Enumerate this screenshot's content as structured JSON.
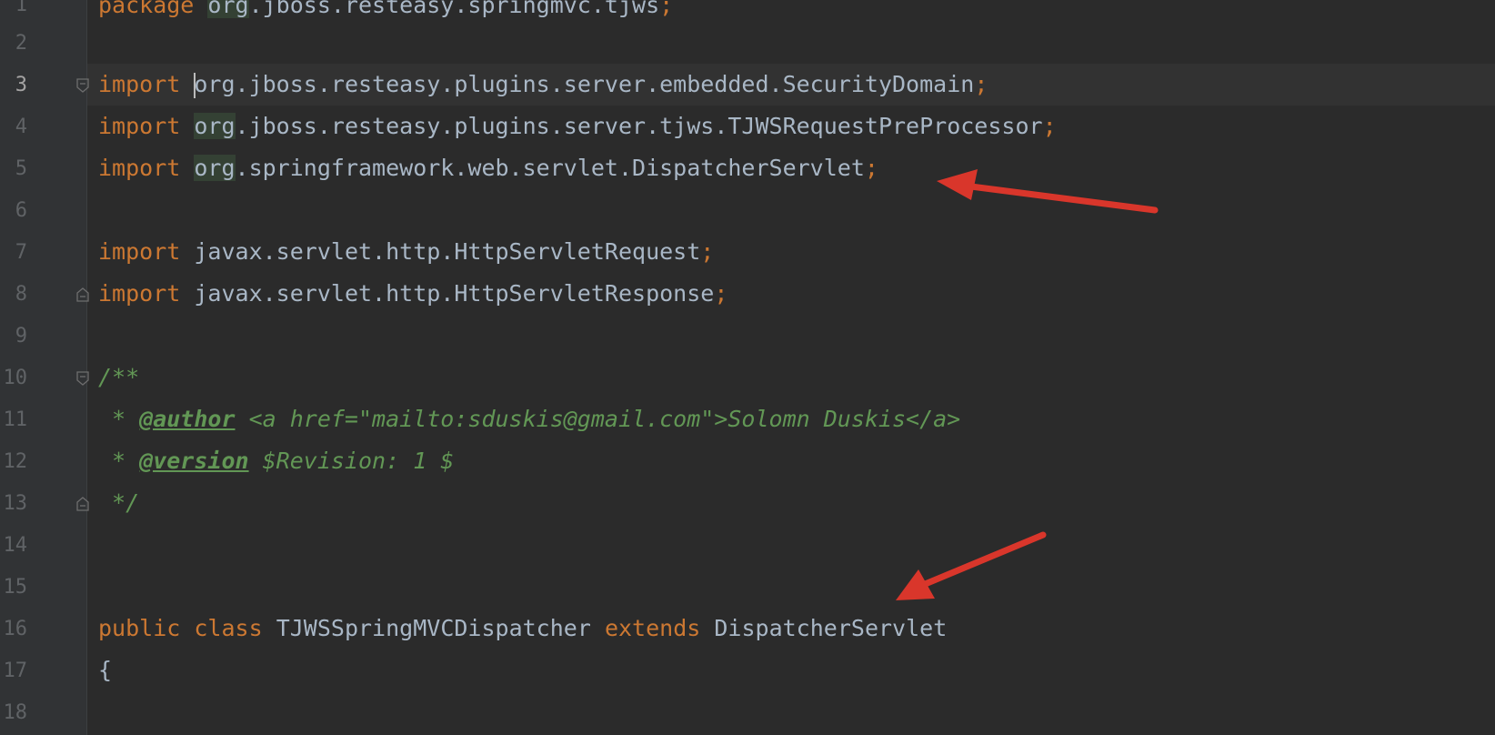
{
  "editor": {
    "current_line": 3,
    "colors": {
      "background": "#2b2b2b",
      "gutter": "#313335",
      "keyword": "#cc7832",
      "identifier": "#a9b7c6",
      "comment": "#629755",
      "annotation_arrow": "#d9362b"
    },
    "line_numbers": [
      "1",
      "2",
      "3",
      "4",
      "5",
      "6",
      "7",
      "8",
      "9",
      "10",
      "11",
      "12",
      "13",
      "14",
      "15",
      "16",
      "17",
      "18"
    ],
    "lines": {
      "l1": {
        "keyword": "package",
        "pkg_hl": "org",
        "rest": ".jboss.resteasy.springmvc.tjws",
        "semi": ";"
      },
      "l3": {
        "keyword": "import",
        "pkg_hl": "org",
        "rest": ".jboss.resteasy.plugins.server.embedded.SecurityDomain",
        "semi": ";"
      },
      "l4": {
        "keyword": "import",
        "pkg_hl": "org",
        "rest": ".jboss.resteasy.plugins.server.tjws.TJWSRequestPreProcessor",
        "semi": ";"
      },
      "l5": {
        "keyword": "import",
        "pkg_hl": "org",
        "rest": ".springframework.web.servlet.DispatcherServlet",
        "semi": ";"
      },
      "l7": {
        "keyword": "import",
        "rest": "javax.servlet.http.HttpServletRequest",
        "semi": ";"
      },
      "l8": {
        "keyword": "import",
        "rest": "javax.servlet.http.HttpServletResponse",
        "semi": ";"
      },
      "l10": {
        "text": "/**"
      },
      "l11": {
        "prefix": " * ",
        "tag": "@author",
        "text": " <a href=\"mailto:sduskis@gmail.com\">Solomn Duskis</a>"
      },
      "l12": {
        "prefix": " * ",
        "tag": "@version",
        "text": " $Revision: 1 $"
      },
      "l13": {
        "text": " */"
      },
      "l16": {
        "kw1": "public",
        "kw2": "class",
        "name": "TJWSSpringMVCDispatcher",
        "kw3": "extends",
        "parent": "DispatcherServlet"
      },
      "l17": {
        "text": "{"
      }
    }
  }
}
